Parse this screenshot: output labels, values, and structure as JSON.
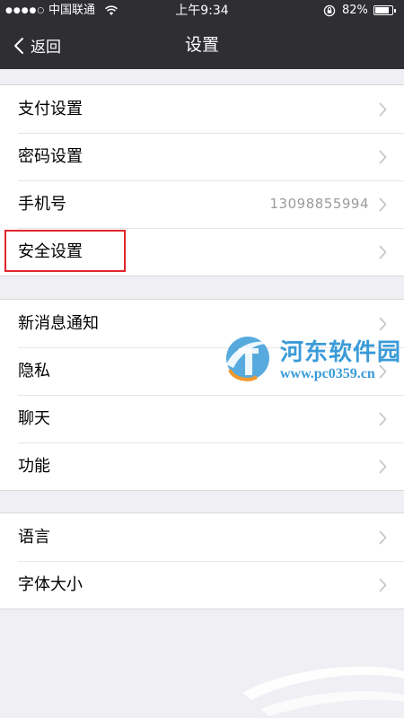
{
  "status_bar": {
    "signal": "●●●●○",
    "carrier": "中国联通",
    "time": "上午9:34",
    "battery_percent_label": "82%",
    "battery_level": 0.82
  },
  "nav": {
    "back_label": "返回",
    "title": "设置"
  },
  "groups": [
    {
      "items": [
        {
          "label": "支付设置",
          "value": ""
        },
        {
          "label": "密码设置",
          "value": ""
        },
        {
          "label": "手机号",
          "value": "13098855994"
        },
        {
          "label": "安全设置",
          "value": "",
          "highlighted": true
        }
      ]
    },
    {
      "items": [
        {
          "label": "新消息通知",
          "value": ""
        },
        {
          "label": "隐私",
          "value": ""
        },
        {
          "label": "聊天",
          "value": ""
        },
        {
          "label": "功能",
          "value": ""
        }
      ]
    },
    {
      "items": [
        {
          "label": "语言",
          "value": ""
        },
        {
          "label": "字体大小",
          "value": ""
        }
      ]
    }
  ],
  "watermark": {
    "name": "河东软件园",
    "url": "www.pc0359.cn"
  },
  "colors": {
    "header_bg": "#2e2e33",
    "page_bg": "#efeff4",
    "highlight_border": "#e0252b",
    "watermark": "#3a9bd8"
  }
}
